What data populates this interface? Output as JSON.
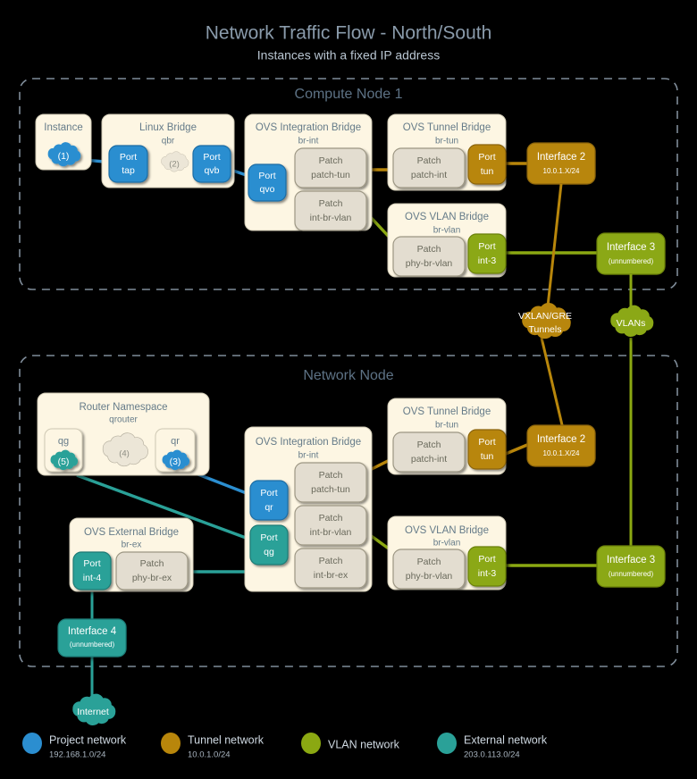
{
  "header": {
    "title": "Network Traffic Flow - North/South",
    "subtitle": "Instances with a fixed IP address"
  },
  "colors": {
    "project": "#2b8ed0",
    "tunnel": "#b8860b",
    "vlan": "#8ba812",
    "external": "#2aa198",
    "panel": "#fdf6e3",
    "patch": "#e3ddd0",
    "frame": "#7f8c99",
    "background": "#000000"
  },
  "compute_node": {
    "title": "Compute Node 1",
    "instance": {
      "title": "Instance",
      "cloud_label": "(1)"
    },
    "linux_bridge": {
      "title": "Linux Bridge",
      "subtitle": "qbr",
      "port_tap": {
        "line1": "Port",
        "line2": "tap"
      },
      "cloud_label": "(2)",
      "port_qvb": {
        "line1": "Port",
        "line2": "qvb"
      }
    },
    "integration_bridge": {
      "title": "OVS Integration Bridge",
      "subtitle": "br-int",
      "port_qvo": {
        "line1": "Port",
        "line2": "qvo"
      },
      "patch_tun": {
        "line1": "Patch",
        "line2": "patch-tun"
      },
      "patch_vlan": {
        "line1": "Patch",
        "line2": "int-br-vlan"
      }
    },
    "tunnel_bridge": {
      "title": "OVS Tunnel Bridge",
      "subtitle": "br-tun",
      "patch_int": {
        "line1": "Patch",
        "line2": "patch-int"
      },
      "port_tun": {
        "line1": "Port",
        "line2": "tun"
      }
    },
    "vlan_bridge": {
      "title": "OVS VLAN Bridge",
      "subtitle": "br-vlan",
      "patch_phy": {
        "line1": "Patch",
        "line2": "phy-br-vlan"
      },
      "port_int3": {
        "line1": "Port",
        "line2": "int-3"
      }
    },
    "interface2": {
      "title": "Interface 2",
      "subtitle": "10.0.1.X/24"
    },
    "interface3": {
      "title": "Interface 3",
      "subtitle": "(unnumbered)"
    }
  },
  "clouds": {
    "tunnels": {
      "line1": "VXLAN/GRE",
      "line2": "Tunnels"
    },
    "vlans": {
      "line1": "VLANs"
    },
    "internet": {
      "line1": "Internet"
    }
  },
  "network_node": {
    "title": "Network Node",
    "router_namespace": {
      "title": "Router Namespace",
      "subtitle": "qrouter",
      "qg": {
        "name": "qg",
        "cloud_label": "(5)"
      },
      "inner_cloud": "(4)",
      "qr": {
        "name": "qr",
        "cloud_label": "(3)"
      }
    },
    "integration_bridge": {
      "title": "OVS Integration Bridge",
      "subtitle": "br-int",
      "port_qr": {
        "line1": "Port",
        "line2": "qr"
      },
      "port_qg": {
        "line1": "Port",
        "line2": "qg"
      },
      "patch_tun": {
        "line1": "Patch",
        "line2": "patch-tun"
      },
      "patch_vlan": {
        "line1": "Patch",
        "line2": "int-br-vlan"
      },
      "patch_ex": {
        "line1": "Patch",
        "line2": "int-br-ex"
      }
    },
    "tunnel_bridge": {
      "title": "OVS Tunnel Bridge",
      "subtitle": "br-tun",
      "patch_int": {
        "line1": "Patch",
        "line2": "patch-int"
      },
      "port_tun": {
        "line1": "Port",
        "line2": "tun"
      }
    },
    "vlan_bridge": {
      "title": "OVS VLAN Bridge",
      "subtitle": "br-vlan",
      "patch_phy": {
        "line1": "Patch",
        "line2": "phy-br-vlan"
      },
      "port_int3": {
        "line1": "Port",
        "line2": "int-3"
      }
    },
    "external_bridge": {
      "title": "OVS External Bridge",
      "subtitle": "br-ex",
      "port_int4": {
        "line1": "Port",
        "line2": "int-4"
      },
      "patch_phy_ex": {
        "line1": "Patch",
        "line2": "phy-br-ex"
      }
    },
    "interface2": {
      "title": "Interface 2",
      "subtitle": "10.0.1.X/24"
    },
    "interface3": {
      "title": "Interface 3",
      "subtitle": "(unnumbered)"
    },
    "interface4": {
      "title": "Interface 4",
      "subtitle": "(unnumbered)"
    }
  },
  "legend": [
    {
      "label": "Project network",
      "subnet": "192.168.1.0/24",
      "color": "#2b8ed0"
    },
    {
      "label": "Tunnel network",
      "subnet": "10.0.1.0/24",
      "color": "#b8860b"
    },
    {
      "label": "VLAN network",
      "subnet": "",
      "color": "#8ba812"
    },
    {
      "label": "External network",
      "subnet": "203.0.113.0/24",
      "color": "#2aa198"
    }
  ]
}
